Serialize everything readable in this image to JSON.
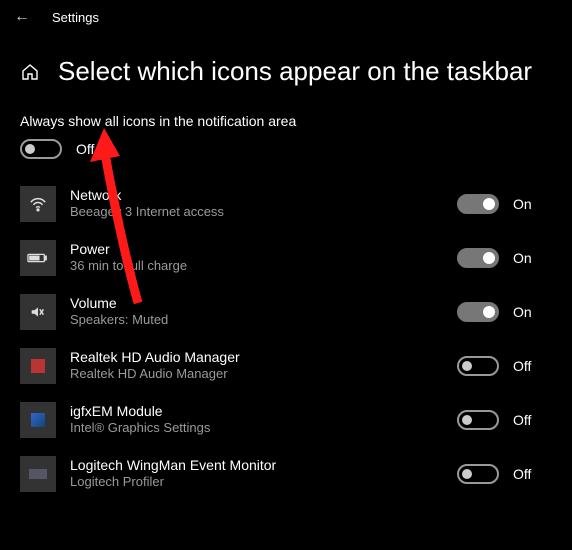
{
  "header": {
    "back_glyph": "←",
    "settings_label": "Settings"
  },
  "title": "Select which icons appear on the taskbar",
  "master": {
    "label": "Always show all icons in the notification area",
    "state": "Off",
    "on": false
  },
  "state_labels": {
    "on": "On",
    "off": "Off"
  },
  "items": [
    {
      "icon": "wifi-icon",
      "title": "Network",
      "sub": "Beeagey 3 Internet access",
      "on": true
    },
    {
      "icon": "battery-icon",
      "title": "Power",
      "sub": "36 min to full charge",
      "on": true
    },
    {
      "icon": "volume-mute-icon",
      "title": "Volume",
      "sub": "Speakers: Muted",
      "on": true
    },
    {
      "icon": "realtek-icon",
      "title": "Realtek HD Audio Manager",
      "sub": "Realtek HD Audio Manager",
      "on": false
    },
    {
      "icon": "intel-icon",
      "title": "igfxEM Module",
      "sub": "Intel® Graphics Settings",
      "on": false
    },
    {
      "icon": "logitech-icon",
      "title": "Logitech WingMan Event Monitor",
      "sub": "Logitech Profiler",
      "on": false
    }
  ]
}
